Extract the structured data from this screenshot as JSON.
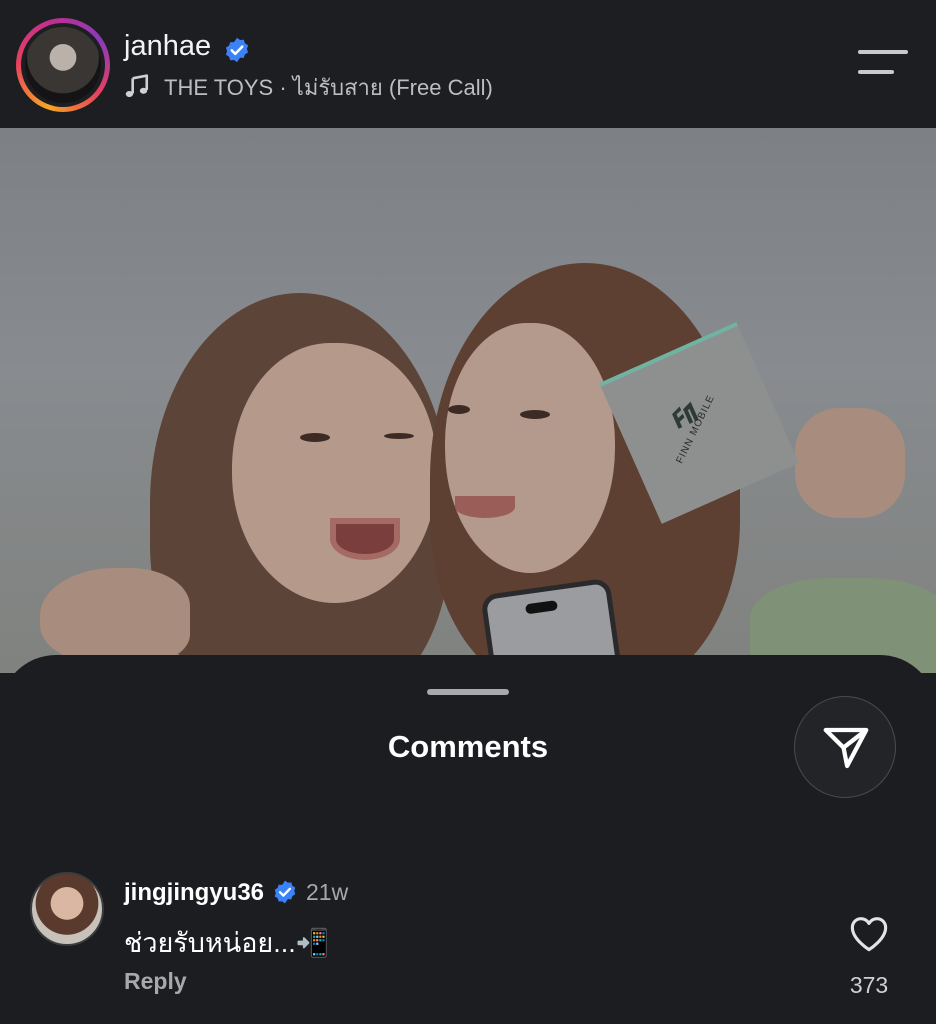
{
  "header": {
    "username": "janhae",
    "verified": true,
    "music_text": "THE TOYS · ไม่รับสาย (Free Call)",
    "avatar_icon": "profile-avatar",
    "music_icon": "music-note-icon",
    "menu_icon": "menu-icon"
  },
  "photo": {
    "card_text": "FINN MOBILE"
  },
  "comments_sheet": {
    "title": "Comments",
    "share_icon": "send-icon",
    "comments": [
      {
        "username": "jingjingyu36",
        "verified": true,
        "time": "21w",
        "text": "ช่วยรับหน่อย...📲",
        "reply_label": "Reply",
        "likes": "373"
      }
    ]
  },
  "colors": {
    "background": "#1c1d21",
    "verified_blue": "#3b82f6",
    "secondary_text": "#a8a8ab"
  }
}
